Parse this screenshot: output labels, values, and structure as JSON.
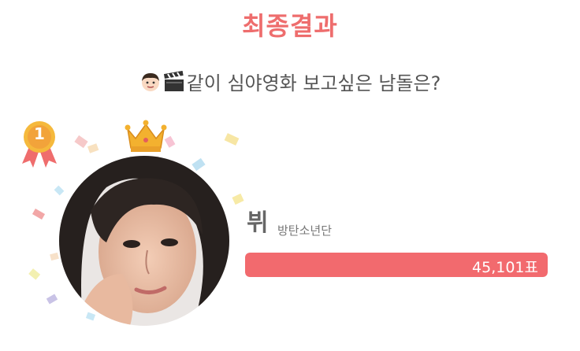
{
  "header": {
    "title": "최종결과"
  },
  "question": {
    "icons": [
      "man-face-icon",
      "clapper-board-icon"
    ],
    "text": "같이 심야영화 보고싶은 남돌은?"
  },
  "winner": {
    "rank": "1",
    "rank_icon": "gold-medal-icon",
    "crown_icon": "crown-icon",
    "name": "뷔",
    "group": "방탄소년단",
    "votes_label": "45,101표",
    "vote_share": 1.0,
    "colors": {
      "bar": "#f26a6e",
      "title": "#ee6d6d",
      "medal": "#f2a33a"
    }
  }
}
